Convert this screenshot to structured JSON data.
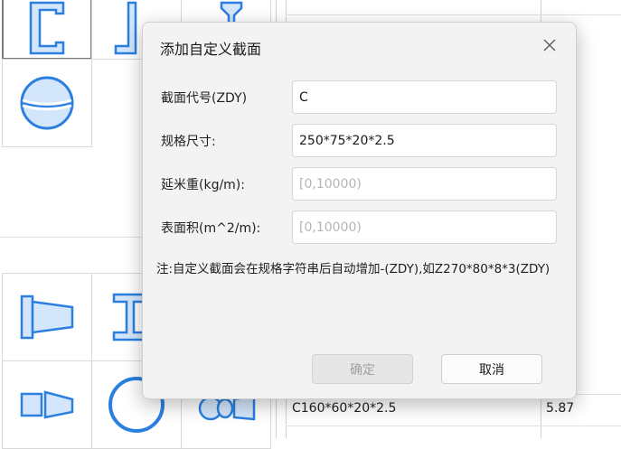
{
  "background": {
    "table_row_text": "C160*60*20*2.5",
    "table_row_value": "5.87"
  },
  "dialog": {
    "title": "添加自定义截面",
    "fields": [
      {
        "label": "截面代号(ZDY)",
        "value": "C",
        "placeholder": ""
      },
      {
        "label": "规格尺寸:",
        "value": "250*75*20*2.5",
        "placeholder": ""
      },
      {
        "label": "延米重(kg/m):",
        "value": "",
        "placeholder": "[0,10000)"
      },
      {
        "label": "表面积(m^2/m):",
        "value": "",
        "placeholder": "[0,10000)"
      }
    ],
    "note": "注:自定义截面会在规格字符串后自动增加-(ZDY),如Z270*80*8*3(ZDY)",
    "ok_label": "确定",
    "cancel_label": "取消"
  },
  "colors": {
    "icon_blue": "#2a7fe0",
    "icon_fill": "#d4e6fb",
    "dialog_bg": "#f3f3f3"
  }
}
